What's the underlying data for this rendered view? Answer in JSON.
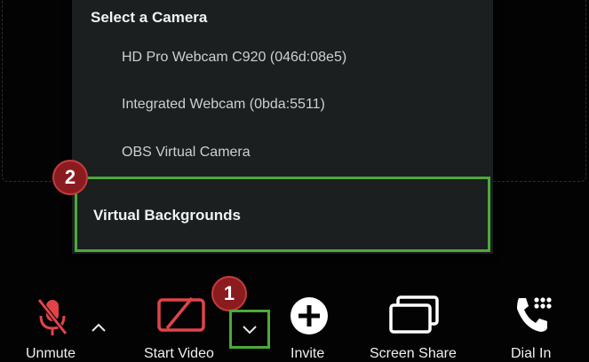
{
  "camera_menu": {
    "title": "Select a Camera",
    "cameras": [
      "HD Pro Webcam C920 (046d:08e5)",
      "Integrated Webcam (0bda:5511)",
      "OBS Virtual Camera"
    ],
    "virtual_backgrounds_label": "Virtual Backgrounds"
  },
  "annotations": {
    "step1": "1",
    "step2": "2",
    "highlight_color": "#4caa3a",
    "badge_color": "#8a1c1f"
  },
  "toolbar": {
    "unmute_label": "Unmute",
    "start_video_label": "Start Video",
    "invite_label": "Invite",
    "screen_share_label": "Screen Share",
    "dial_in_label": "Dial In",
    "muted_color": "#e0444a"
  }
}
